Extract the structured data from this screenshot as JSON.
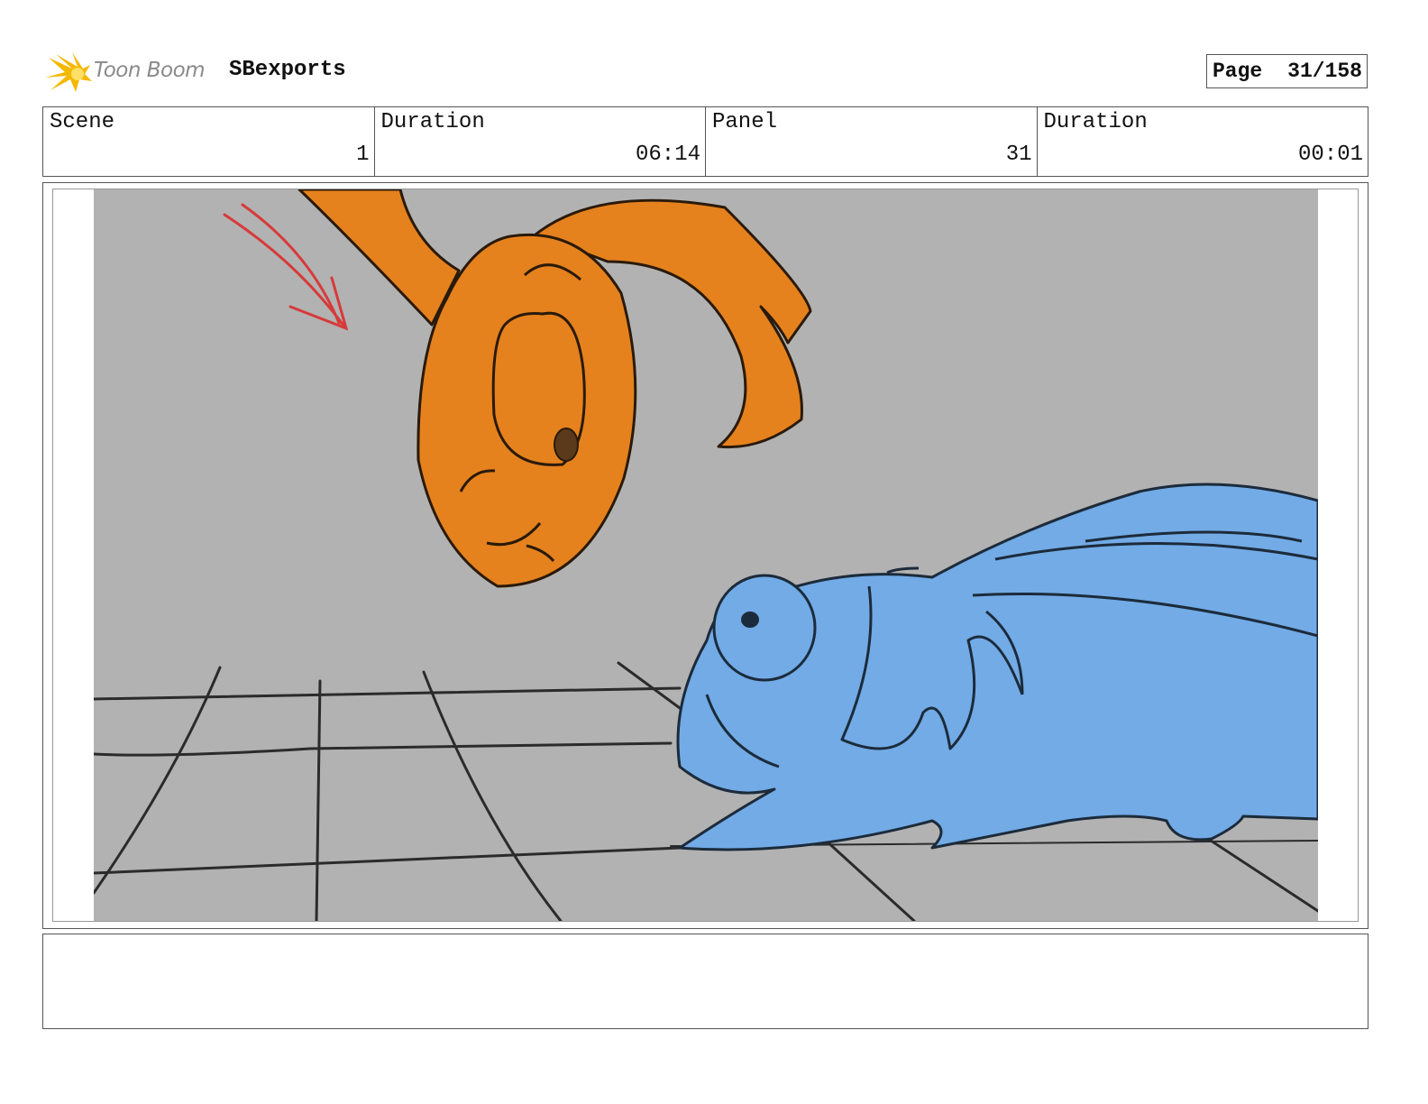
{
  "header": {
    "logo_text": "Toon Boom",
    "project_name": "SBexports",
    "page_label": "Page",
    "page_value": "31/158"
  },
  "info": {
    "scene_label": "Scene",
    "scene_value": "1",
    "scene_duration_label": "Duration",
    "scene_duration_value": "06:14",
    "panel_label": "Panel",
    "panel_value": "31",
    "panel_duration_label": "Duration",
    "panel_duration_value": "00:01"
  },
  "colors": {
    "background": "#b2b2b2",
    "orange_character": "#e5821e",
    "blue_character": "#72abe6",
    "direction_arrow": "#d73a3a",
    "logo_star": "#f5b800"
  },
  "notes": {
    "text": ""
  }
}
